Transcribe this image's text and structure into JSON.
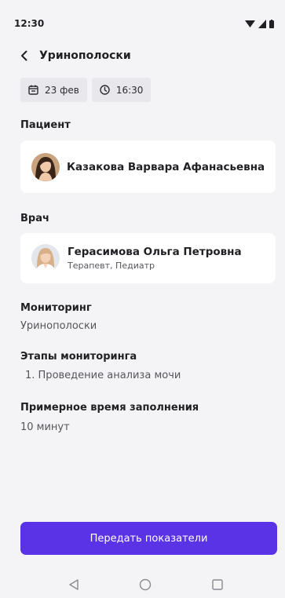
{
  "status_bar": {
    "time": "12:30"
  },
  "header": {
    "title": "Уринополоски"
  },
  "chips": {
    "date": "23 фев",
    "time": "16:30"
  },
  "patient": {
    "label": "Пациент",
    "name": "Казакова Варвара Афанасьевна"
  },
  "doctor": {
    "label": "Врач",
    "name": "Герасимова Ольга Петровна",
    "specialty": "Терапевт, Педиатр"
  },
  "monitoring": {
    "label": "Мониторинг",
    "value": "Уринополоски"
  },
  "stages": {
    "label": "Этапы мониторинга",
    "items": [
      "1. Проведение анализа мочи"
    ]
  },
  "estimated_time": {
    "label": "Примерное время заполнения",
    "value": "10 минут"
  },
  "submit_button": {
    "label": "Передать показатели"
  },
  "colors": {
    "accent": "#5a33e6",
    "background": "#f4f4f6",
    "card": "#ffffff"
  },
  "icons": {
    "back": "chevron-left-icon",
    "calendar": "calendar-icon",
    "clock": "clock-icon",
    "nav_back": "triangle-back-icon",
    "nav_home": "circle-home-icon",
    "nav_recents": "square-recents-icon"
  }
}
